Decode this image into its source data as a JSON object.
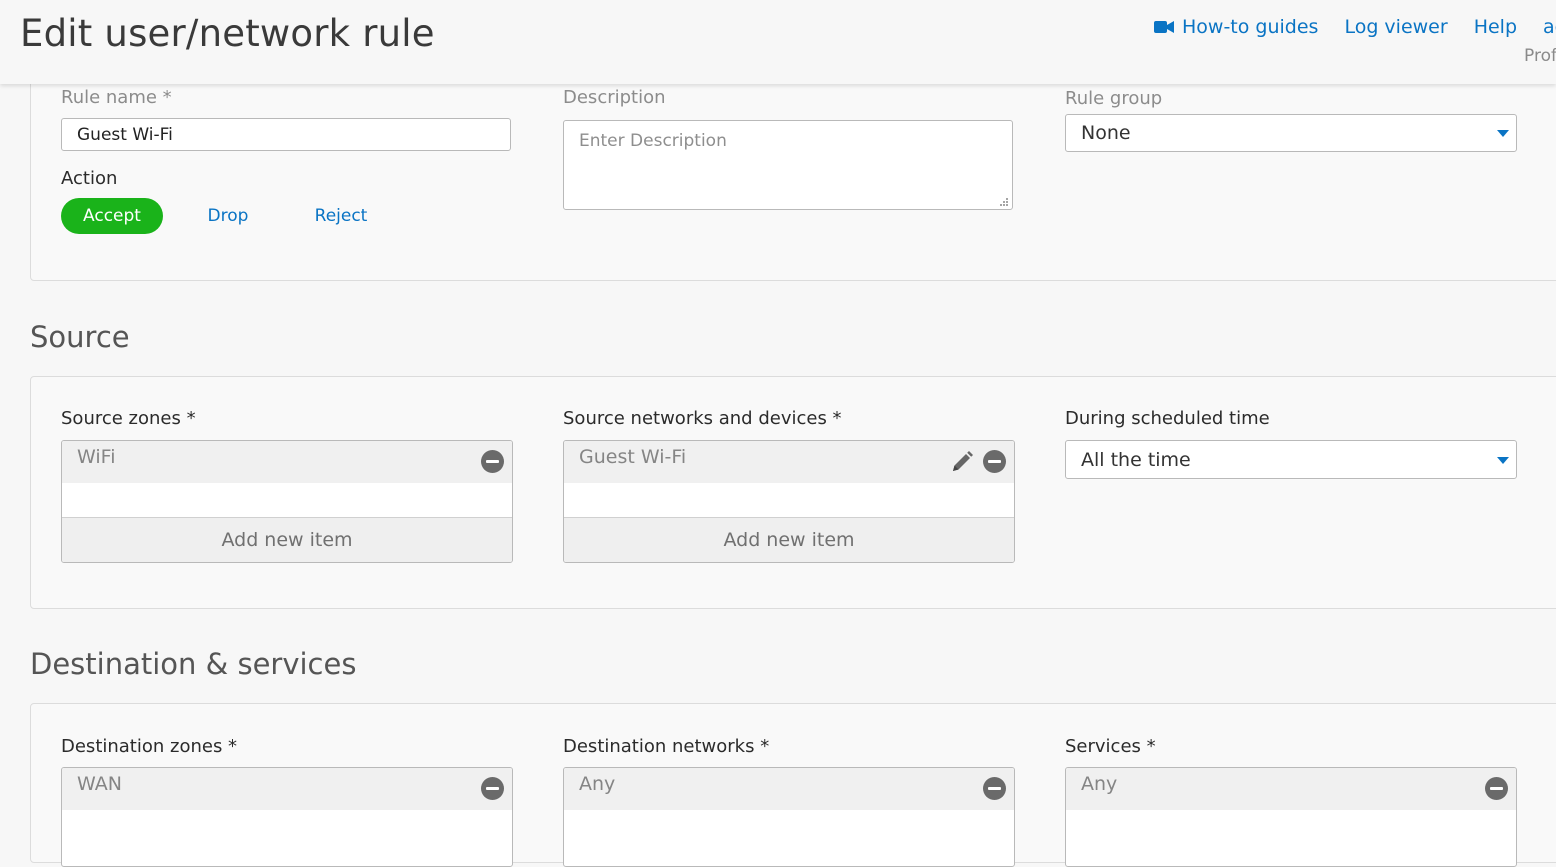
{
  "header": {
    "title": "Edit user/network rule",
    "nav": {
      "howto": "How-to guides",
      "log_viewer": "Log viewer",
      "help": "Help",
      "admin": "adm"
    },
    "profile": "Prof"
  },
  "general": {
    "rule_name_label": "Rule name *",
    "rule_name_value": "Guest Wi-Fi",
    "description_label": "Description",
    "description_placeholder": "Enter Description",
    "rule_group_label": "Rule group",
    "rule_group_value": "None",
    "action_label": "Action",
    "actions": [
      "Accept",
      "Drop",
      "Reject"
    ],
    "selected_action": "Accept"
  },
  "source": {
    "title": "Source",
    "zones_label": "Source zones *",
    "zones": [
      "WiFi"
    ],
    "networks_label": "Source networks and devices *",
    "networks": [
      "Guest Wi-Fi"
    ],
    "add_new_item": "Add new item",
    "schedule_label": "During scheduled time",
    "schedule_value": "All the time"
  },
  "destination": {
    "title": "Destination & services",
    "zones_label": "Destination zones *",
    "zones": [
      "WAN"
    ],
    "networks_label": "Destination networks *",
    "networks": [
      "Any"
    ],
    "services_label": "Services *",
    "services": [
      "Any"
    ]
  },
  "colors": {
    "accent": "#0a74c4",
    "accept_green": "#1ab31a"
  }
}
